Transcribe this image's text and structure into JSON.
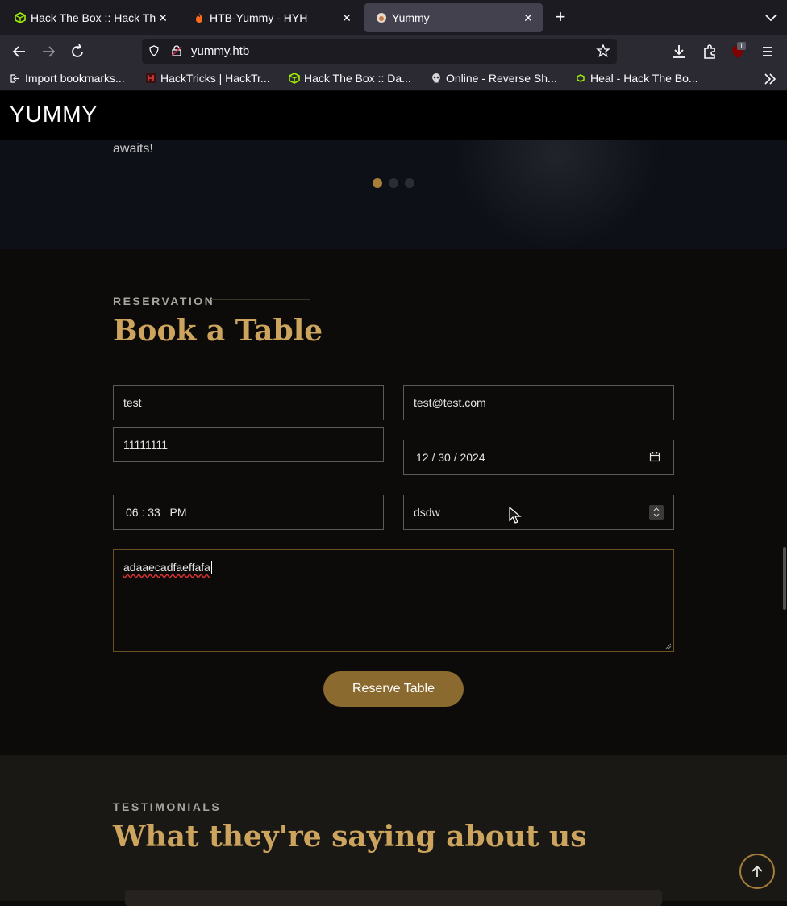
{
  "browser": {
    "tabs": [
      {
        "title": "Hack The Box :: Hack Th",
        "icon": "htb-cube-icon",
        "active": false
      },
      {
        "title": "HTB-Yummy - HYH",
        "icon": "flame-icon",
        "active": false
      },
      {
        "title": "Yummy",
        "icon": "yummy-favicon",
        "active": true
      }
    ],
    "url": "yummy.htb",
    "extension_badge": "1",
    "bookmarks": [
      {
        "label": "Import bookmarks...",
        "icon": "import-icon"
      },
      {
        "label": "HackTricks | HackTr...",
        "icon": "hacktricks-icon"
      },
      {
        "label": "Hack The Box :: Da...",
        "icon": "htb-cube-icon"
      },
      {
        "label": "Online - Reverse Sh...",
        "icon": "skull-icon"
      },
      {
        "label": "Heal - Hack The Bo...",
        "icon": "htb-small-icon"
      }
    ]
  },
  "site": {
    "logo": "YUMMY",
    "hero_text": "Let us take care of the details so you can relax and enjoy the party. Your perfect birthday bash awaits!",
    "carousel_active_index": 0,
    "reservation": {
      "kicker": "RESERVATION",
      "title": "Book a Table",
      "name_value": "test",
      "email_value": "test@test.com",
      "phone_value": "11111111",
      "date_value": "12 / 30 / 2024",
      "time_value": "06 : 33   PM",
      "people_value": "dsdw",
      "message_value": "adaaecadfaeffafa",
      "submit_label": "Reserve Table"
    },
    "testimonials": {
      "kicker": "TESTIMONIALS",
      "title": "What they're saying about us"
    }
  },
  "colors": {
    "accent": "#cda45e",
    "button": "#8b6a2f",
    "page_bg": "#0c0b09"
  }
}
